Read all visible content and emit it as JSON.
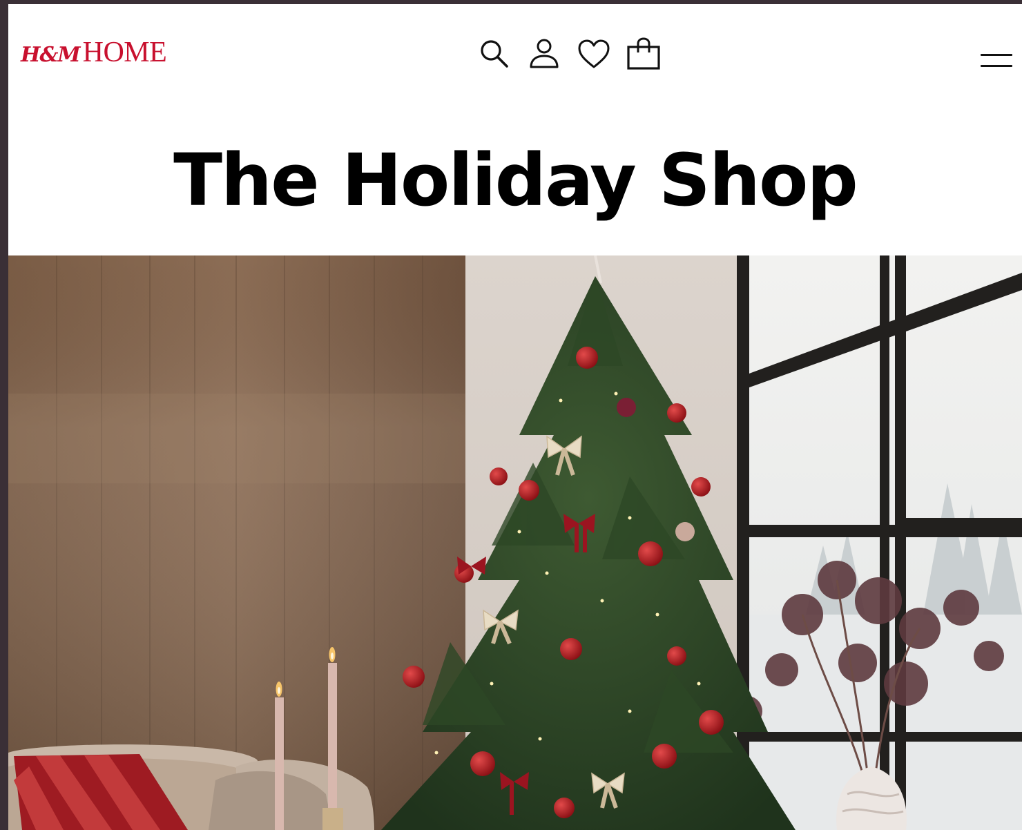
{
  "header": {
    "logo_mark": "H&M",
    "logo_text": "HOME",
    "icons": [
      "search-icon",
      "account-icon",
      "heart-icon",
      "bag-icon",
      "menu-icon"
    ]
  },
  "hero": {
    "title": "The Holiday Shop"
  },
  "colors": {
    "brand": "#c8102e",
    "background": "#ffffff",
    "text": "#000000"
  }
}
